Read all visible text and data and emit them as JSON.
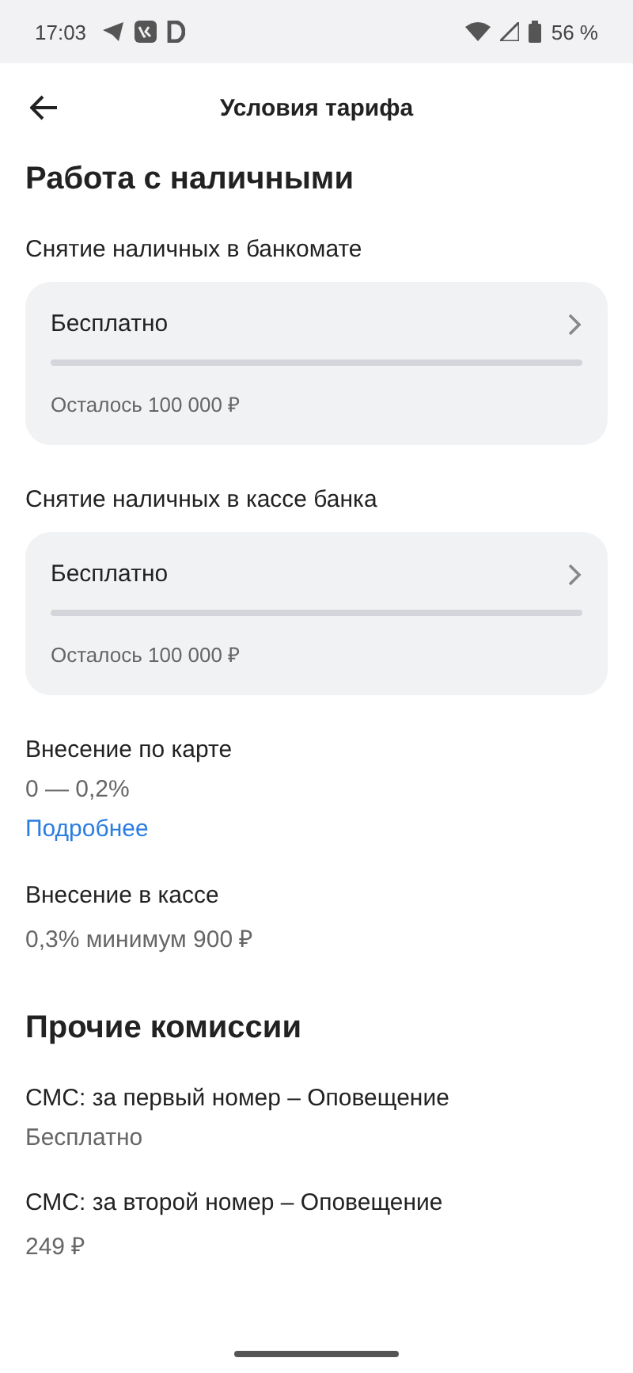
{
  "status_bar": {
    "time": "17:03",
    "battery": "56 %"
  },
  "header": {
    "title": "Условия тарифа"
  },
  "sections": [
    {
      "title": "Работа с наличными",
      "items": [
        {
          "kind": "card",
          "label": "Снятие наличных в банкомате",
          "value": "Бесплатно",
          "remaining": "Осталось 100 000 ₽",
          "level": 1
        },
        {
          "kind": "card",
          "label": "Снятие наличных в кассе банка",
          "value": "Бесплатно",
          "remaining": "Осталось 100 000 ₽",
          "level": 1
        },
        {
          "kind": "plain",
          "label": "Внесение по карте",
          "value": "0 — 0,2%",
          "link": "Подробнее"
        },
        {
          "kind": "plain",
          "label": "Внесение в кассе",
          "value": "0,3% минимум 900 ₽"
        }
      ]
    },
    {
      "title": "Прочие комиссии",
      "items": [
        {
          "kind": "plain",
          "label": "СМС: за первый номер – Оповещение",
          "value": "Бесплатно"
        },
        {
          "kind": "plain",
          "label": "СМС: за второй номер – Оповещение",
          "value": "249 ₽"
        }
      ]
    }
  ]
}
